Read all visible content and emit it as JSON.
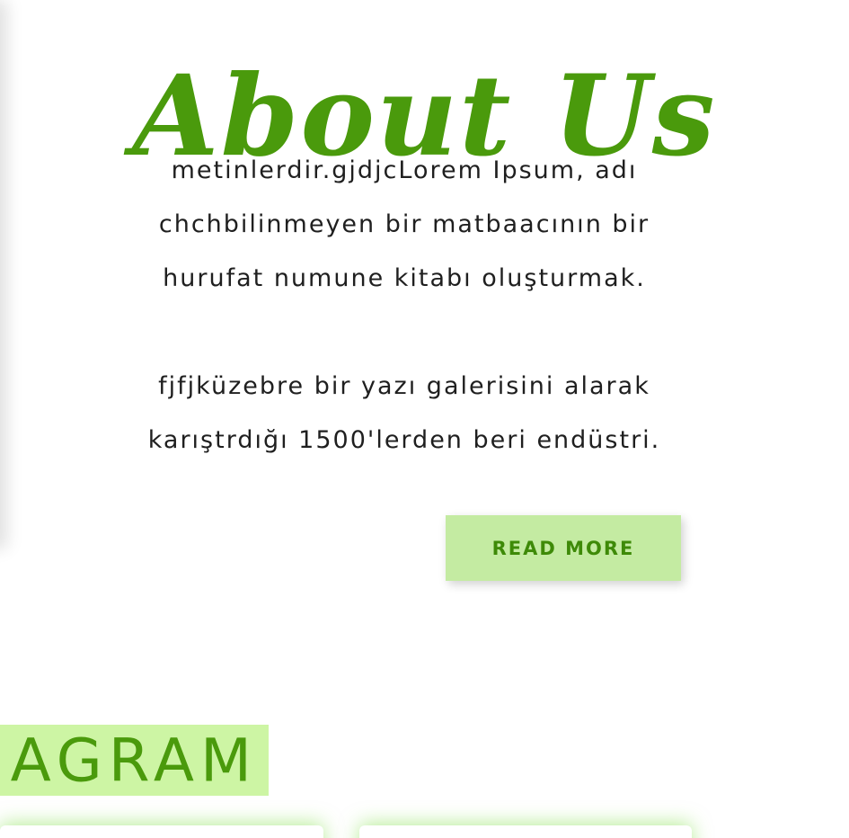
{
  "about": {
    "title": "About Us",
    "paragraph1": [
      "metinlerdir.gjdjcLorem Ipsum, adı",
      "chchbilinmeyen bir matbaacının bir",
      "hurufat numune kitabı oluşturmak."
    ],
    "paragraph2": [
      "fjfjküzebre bir yazı galerisini alarak",
      "karıştrdığı 1500'lerden beri endüstri."
    ],
    "read_more_label": "READ MORE"
  },
  "instagram": {
    "heading": "AGRAM"
  },
  "colors": {
    "accent_green": "#4a9a0c",
    "button_bg": "#c4eba2",
    "heading_bg": "#cdf5a4",
    "text": "#1f1f1f"
  }
}
